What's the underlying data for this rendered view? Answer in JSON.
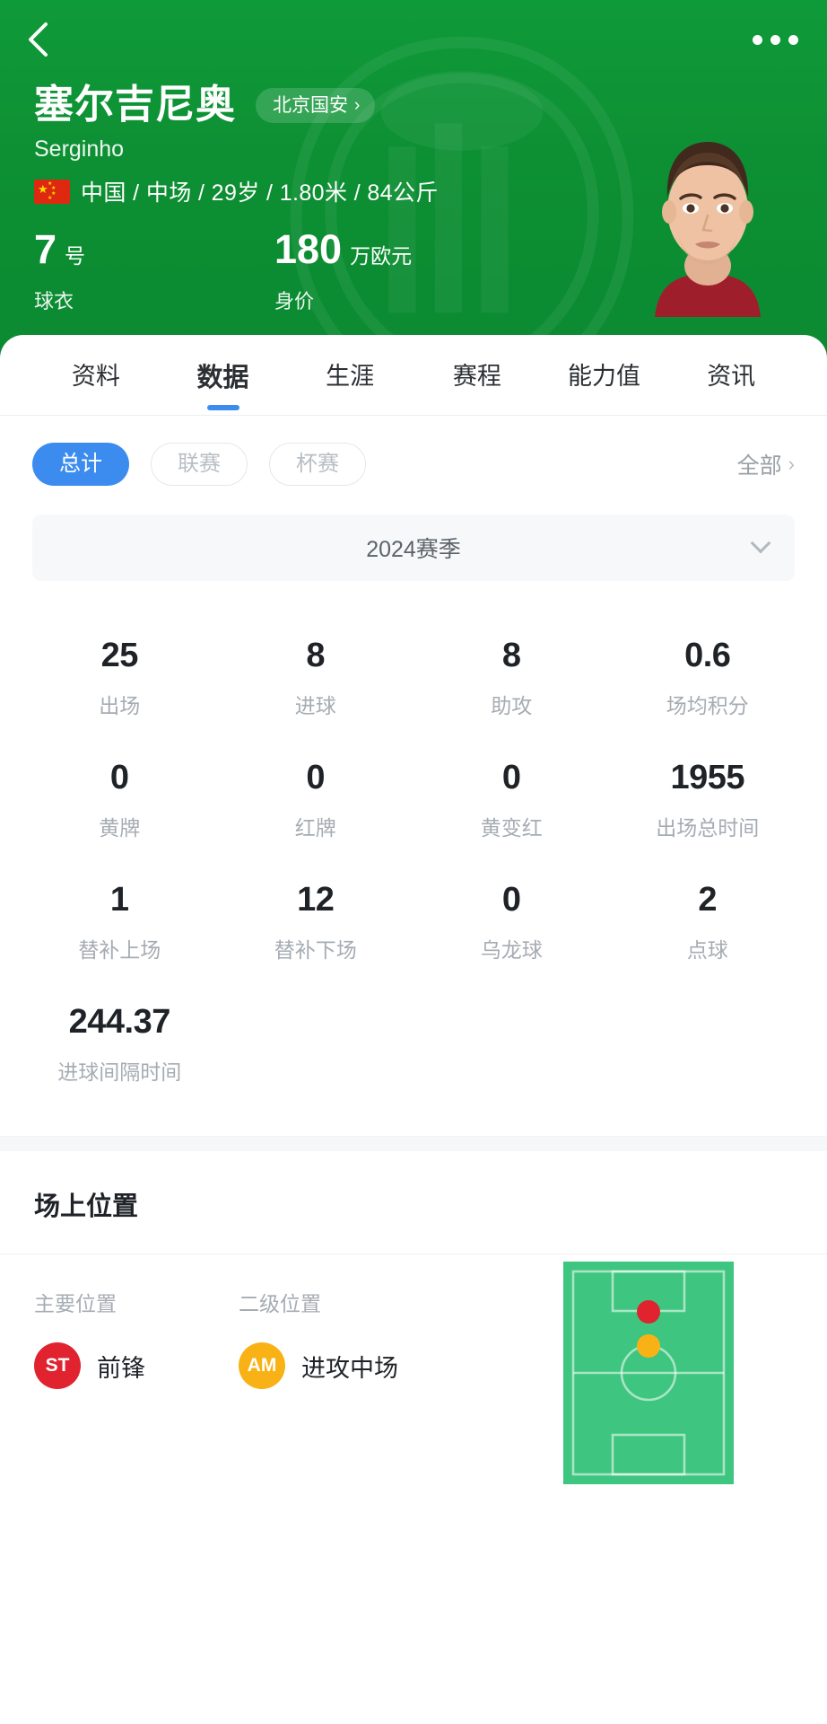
{
  "theme": {
    "brand_green": "#0d8f33",
    "accent_blue": "#3c8cf0",
    "pitch_green": "#3ec57f",
    "primary_pos_color": "#e0232e",
    "secondary_pos_color": "#f9b216"
  },
  "topbar": {
    "back_icon": "chevron-left-icon",
    "more_icon": "more-horizontal-icon"
  },
  "player": {
    "name": "塞尔吉尼奥",
    "alias": "Serginho",
    "team": "北京国安",
    "team_chevron": "›",
    "nationality_flag": "china-flag-icon",
    "meta": "中国 / 中场 / 29岁 / 1.80米 / 84公斤",
    "kpis": [
      {
        "value": "7",
        "unit": "号",
        "label": "球衣"
      },
      {
        "value": "180",
        "unit": "万欧元",
        "label": "身价"
      }
    ]
  },
  "tabs": [
    {
      "label": "资料",
      "active": false
    },
    {
      "label": "数据",
      "active": true
    },
    {
      "label": "生涯",
      "active": false
    },
    {
      "label": "赛程",
      "active": false
    },
    {
      "label": "能力值",
      "active": false
    },
    {
      "label": "资讯",
      "active": false
    }
  ],
  "filters": {
    "pills": [
      {
        "label": "总计",
        "active": true
      },
      {
        "label": "联赛",
        "active": false
      },
      {
        "label": "杯赛",
        "active": false
      }
    ],
    "all_label": "全部",
    "all_chevron": "›"
  },
  "season": {
    "label": "2024赛季",
    "caret_icon": "chevron-down-icon"
  },
  "stats": [
    {
      "value": "25",
      "label": "出场"
    },
    {
      "value": "8",
      "label": "进球"
    },
    {
      "value": "8",
      "label": "助攻"
    },
    {
      "value": "0.6",
      "label": "场均积分"
    },
    {
      "value": "0",
      "label": "黄牌"
    },
    {
      "value": "0",
      "label": "红牌"
    },
    {
      "value": "0",
      "label": "黄变红"
    },
    {
      "value": "1955",
      "label": "出场总时间"
    },
    {
      "value": "1",
      "label": "替补上场"
    },
    {
      "value": "12",
      "label": "替补下场"
    },
    {
      "value": "0",
      "label": "乌龙球"
    },
    {
      "value": "2",
      "label": "点球"
    },
    {
      "value": "244.37",
      "label": "进球间隔时间"
    }
  ],
  "position_section": {
    "title": "场上位置",
    "primary": {
      "head": "主要位置",
      "badge": "ST",
      "name": "前锋",
      "color": "#e0232e"
    },
    "secondary": {
      "head": "二级位置",
      "badge": "AM",
      "name": "进攻中场",
      "color": "#f9b216"
    },
    "pitch_icon": "football-pitch-icon"
  }
}
